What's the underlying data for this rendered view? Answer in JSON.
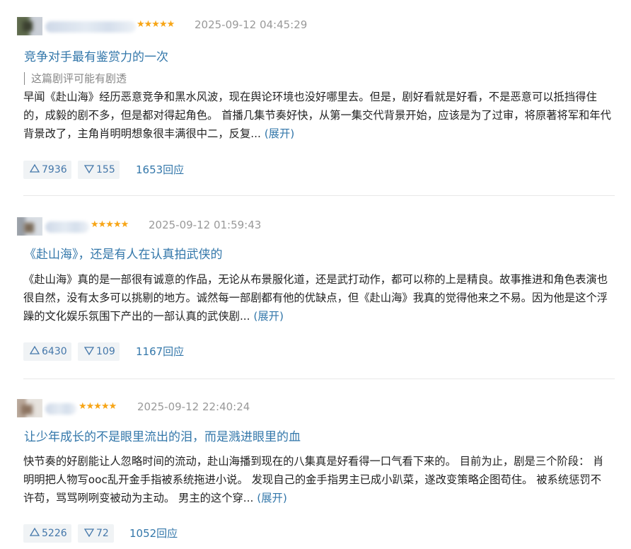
{
  "reviews": [
    {
      "stars": "★★★★★",
      "time": "2025-09-12 04:45:29",
      "title": "竞争对手最有鉴赏力的一次",
      "spoiler": "这篇剧评可能有剧透",
      "body": "早闻《赴山海》经历恶意竞争和黑水风波，现在舆论环境也没好哪里去。但是，剧好看就是好看，不是恶意可以抵挡得住的，成毅的剧不多，但是都对得起角色。 首播几集节奏好快，从第一集交代背景开始，应该是为了过审，将原著将军和年代背景改了，主角肖明明想象很丰满很中二，反复...",
      "expand": "(展开)",
      "up": "7936",
      "down": "155",
      "replies": "1653回应"
    },
    {
      "stars": "★★★★★",
      "time": "2025-09-12 01:59:43",
      "title": "《赴山海》，还是有人在认真拍武侠的",
      "body": "《赴山海》真的是一部很有诚意的作品，无论从布景服化道，还是武打动作，都可以称的上是精良。故事推进和角色表演也很自然，没有太多可以挑剔的地方。诚然每一部剧都有他的优缺点，但《赴山海》我真的觉得他来之不易。因为他是这个浮躁的文化娱乐氛围下产出的一部认真的武侠剧...",
      "expand": "(展开)",
      "up": "6430",
      "down": "109",
      "replies": "1167回应"
    },
    {
      "stars": "★★★★★",
      "time": "2025-09-12 22:40:24",
      "title": "让少年成长的不是眼里流出的泪，而是溅进眼里的血",
      "body": "快节奏的好剧能让人忽略时间的流动，赴山海播到现在的八集真是好看得一口气看下来的。 目前为止，剧是三个阶段： 肖明明把人物写ooc乱开金手指被系统拖进小说。 发现自己的金手指男主已成小趴菜，遂改变策略企图苟住。 被系统惩罚不许苟，骂骂咧咧变被动为主动。 男主的这个穿...",
      "expand": "(展开)",
      "up": "5226",
      "down": "72",
      "replies": "1052回应"
    }
  ]
}
